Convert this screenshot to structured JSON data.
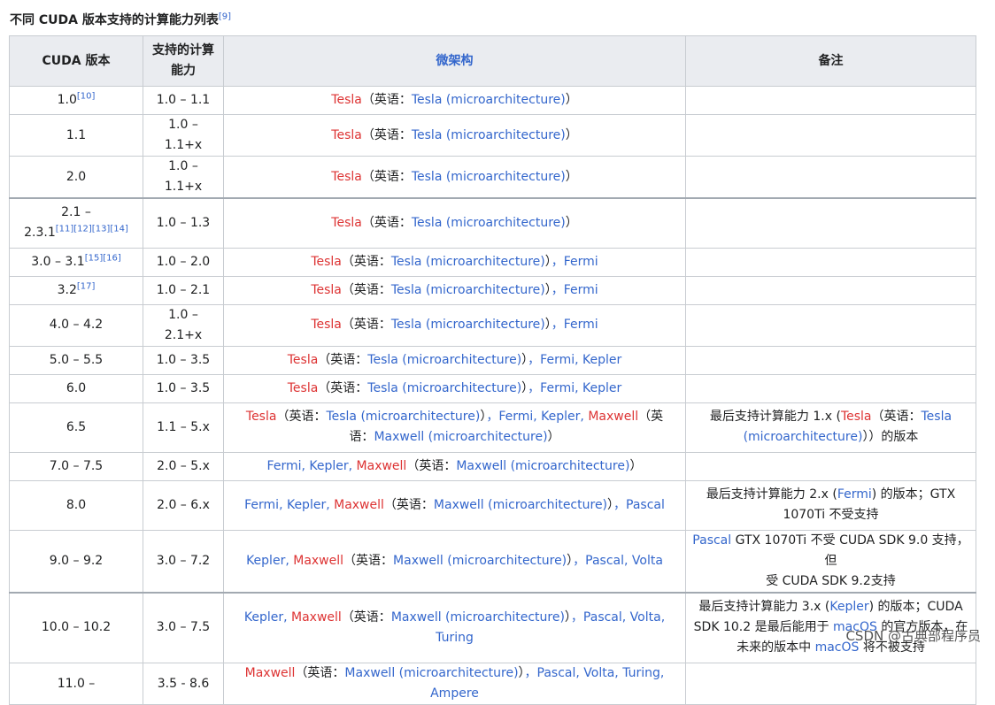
{
  "caption": {
    "text": "不同 CUDA 版本支持的计算能力列表",
    "ref": "[9]"
  },
  "headers": {
    "version": "CUDA 版本",
    "capability": "支持的计算能力",
    "arch": "微架构",
    "notes": "备注"
  },
  "common": {
    "tesla": "Tesla",
    "tesla_micro": "Tesla (microarchitecture)",
    "maxwell_micro": "Maxwell (microarchitecture)",
    "en_open": "（英语：",
    "en_close": "）"
  },
  "rows": [
    {
      "version": "1.0",
      "refs": "[10]",
      "cap": "1.0 – 1.1"
    },
    {
      "version": "1.1",
      "refs": "",
      "cap": "1.0 – 1.1+x"
    },
    {
      "version": "2.0",
      "refs": "",
      "cap": "1.0 – 1.1+x"
    },
    {
      "version_a": "2.1 –",
      "version_b": "2.3.1",
      "refs": "[11][12][13][14]",
      "cap": "1.0 – 1.3"
    },
    {
      "version": "3.0 – 3.1",
      "refs": "[15][16]",
      "cap": "1.0 – 2.0",
      "extra": "，Fermi"
    },
    {
      "version": "3.2",
      "refs": "[17]",
      "cap": "1.0 – 2.1",
      "extra": "，Fermi"
    },
    {
      "version": "4.0 – 4.2",
      "refs": "",
      "cap": "1.0 – 2.1+x",
      "extra": "，Fermi"
    },
    {
      "version": "5.0 – 5.5",
      "refs": "",
      "cap": "1.0 – 3.5",
      "extra": "，Fermi, Kepler"
    },
    {
      "version": "6.0",
      "refs": "",
      "cap": "1.0 – 3.5",
      "extra": "，Fermi, Kepler"
    },
    {
      "version": "6.5",
      "refs": "",
      "cap": "1.1 – 5.x",
      "arch_extra": "，Fermi, Kepler, ",
      "arch_maxwell": "Maxwell",
      "arch_en_open": "（英",
      "arch_en_rest": "语：",
      "note_pre": "最后支持计算能力 1.x (",
      "note_link": "Tesla",
      "note_en": "（英语：",
      "note_micro": "Tesla (microarchitecture)",
      "note_post": "））的版本"
    },
    {
      "version": "7.0 – 7.5",
      "refs": "",
      "cap": "2.0 – 5.x",
      "arch_pre": "Fermi, Kepler, ",
      "arch_maxwell": "Maxwell"
    },
    {
      "version": "8.0",
      "refs": "",
      "cap": "2.0 – 6.x",
      "arch_pre": "Fermi, Kepler, ",
      "arch_maxwell": "Maxwell",
      "arch_extra": "，Pascal",
      "note_pre": "最后支持计算能力 2.x (",
      "note_link": "Fermi",
      "note_post": ") 的版本；GTX",
      "note_line2": "1070Ti 不受支持"
    },
    {
      "version": "9.0 – 9.2",
      "refs": "",
      "cap": "3.0 – 7.2",
      "arch_pre": "Kepler, ",
      "arch_maxwell": "Maxwell",
      "arch_extra": "，Pascal, Volta",
      "note_link": "Pascal",
      "note_post": " GTX 1070Ti 不受 CUDA SDK 9.0 支持，但",
      "note_line2": "受 CUDA SDK 9.2支持"
    },
    {
      "version": "10.0 – 10.2",
      "refs": "",
      "cap": "3.0 – 7.5",
      "arch_pre": "Kepler, ",
      "arch_maxwell": "Maxwell",
      "arch_extra": "，Pascal, Volta, Turing",
      "note_pre": "最后支持计算能力 3.x (",
      "note_link": "Kepler",
      "note_post": ") 的版本；CUDA",
      "note_l2_pre": "SDK 10.2 是最后能用于 ",
      "note_l2_link": "macOS",
      "note_l2_post": " 的官方版本，在",
      "note_l3_pre": "未来的版本中 ",
      "note_l3_link": "macOS",
      "note_l3_post": " 将不被支持"
    },
    {
      "version": "11.0 –",
      "refs": "",
      "cap": "3.5 - 8.6",
      "arch_maxwell": "Maxwell",
      "arch_extra": "，Pascal, Volta, Turing, Ampere"
    }
  ],
  "watermark": "CSDN @古典部程序员"
}
